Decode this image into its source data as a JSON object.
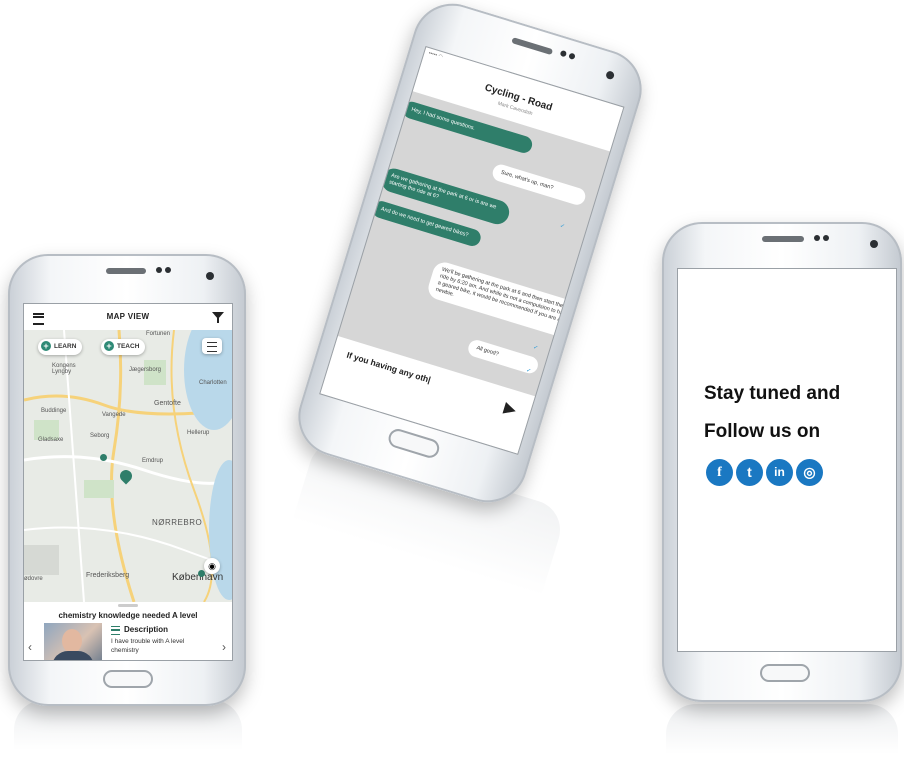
{
  "map_phone": {
    "title": "MAP VIEW",
    "learn_label": "LEARN",
    "teach_label": "TEACH",
    "place_labels": {
      "kongens_lyngby": "Kongens Lyngby",
      "jaegersborg": "Jægersborg",
      "charlotten": "Charlotten",
      "gentofte": "Gentofte",
      "buddinge": "Buddinge",
      "vangede": "Vangede",
      "gladsaxe": "Gladsaxe",
      "seborg": "Seborg",
      "hellerup": "Hellerup",
      "emdrup": "Emdrup",
      "norrebro": "NØRREBRO",
      "frederiksberg": "Frederiksberg",
      "kobenhavn": "København",
      "fortunen": "Fortunen",
      "adovre": "ødovre"
    },
    "card_title": "chemistry knowledge needed A level",
    "card_description_label": "Description",
    "card_description_text": "I have trouble with A level chemistry"
  },
  "chat_phone": {
    "title": "Cycling - Road",
    "subtitle": "Mark Cavendish",
    "messages": [
      {
        "from": "them",
        "text": "Hey, I had some questions."
      },
      {
        "from": "me",
        "text": "Sure, what's up, man?"
      },
      {
        "from": "them",
        "text": "Are we gathering at the park at 6 or is are we starting the ride at 6?"
      },
      {
        "from": "them",
        "text": "And do we need to get geared bikes?"
      },
      {
        "from": "me",
        "text": "We'll be gathering at the park at 6 and then start the ride by 6:20 am. And while its not a compulsion to have a geared bike, it would be recommended if you are a newbie."
      },
      {
        "from": "me",
        "text": "All good?"
      }
    ],
    "input_text": "If you having any oth|"
  },
  "promo_phone": {
    "line1": "Stay tuned and",
    "line2": "Follow us on",
    "social": [
      {
        "icon": "facebook-icon",
        "glyph": "f"
      },
      {
        "icon": "twitter-icon",
        "glyph": "t"
      },
      {
        "icon": "linkedin-icon",
        "glyph": "in"
      },
      {
        "icon": "instagram-icon",
        "glyph": "◎"
      }
    ]
  },
  "colors": {
    "accent_green": "#2f7e6a",
    "social_blue": "#1a78c2"
  }
}
